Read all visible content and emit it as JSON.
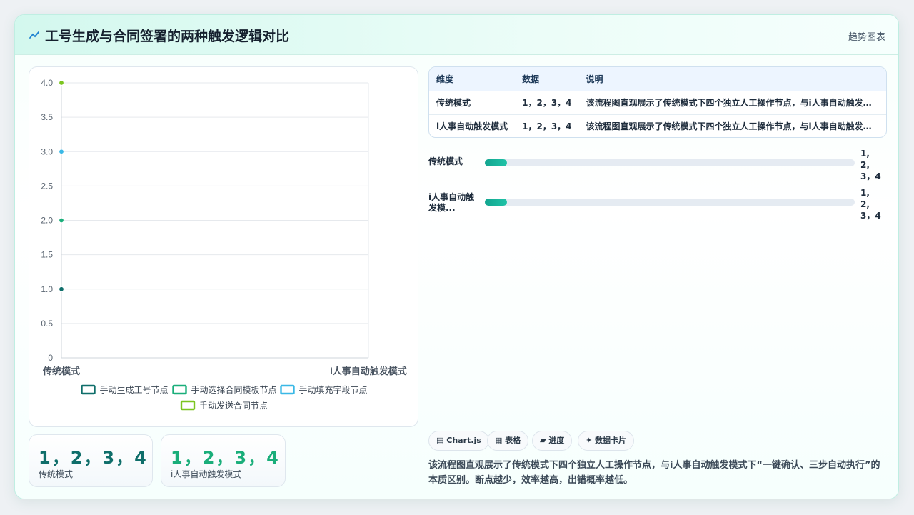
{
  "header": {
    "title": "工号生成与合同签署的两种触发逻辑对比",
    "tag": "趋势图表",
    "icon": "trend-line-icon"
  },
  "chart_data": {
    "type": "scatter",
    "categories": [
      "传统模式",
      "i人事自动触发模式"
    ],
    "ylim": [
      0,
      4
    ],
    "yticks": [
      "0",
      "0.5",
      "1.0",
      "1.5",
      "2.0",
      "2.5",
      "3.0",
      "3.5",
      "4.0"
    ],
    "series": [
      {
        "name": "手动生成工号节点",
        "values": [
          1,
          null
        ],
        "color": "#0f6e6a"
      },
      {
        "name": "手动选择合同模板节点",
        "values": [
          2,
          null
        ],
        "color": "#1aae7a"
      },
      {
        "name": "手动填充字段节点",
        "values": [
          3,
          null
        ],
        "color": "#3ab8e6"
      },
      {
        "name": "手动发送合同节点",
        "values": [
          4,
          null
        ],
        "color": "#7cc520"
      }
    ],
    "legend": "bottom",
    "grid": true
  },
  "stats": [
    {
      "value": "1，2，3，4",
      "label": "传统模式",
      "color": "#0f6e6a"
    },
    {
      "value": "1，2，3，4",
      "label": "i人事自动触发模式",
      "color": "#1aae7a"
    }
  ],
  "table": {
    "headers": [
      "维度",
      "数据",
      "说明"
    ],
    "rows": [
      [
        "传统模式",
        "1，2，3，4",
        "该流程图直观展示了传统模式下四个独立人工操作节点，与i人事自动触发模..."
      ],
      [
        "i人事自动触发模式",
        "1，2，3，4",
        "该流程图直观展示了传统模式下四个独立人工操作节点，与i人事自动触发模..."
      ]
    ]
  },
  "progress": [
    {
      "label": "传统模式",
      "value_lines": [
        "1,",
        "2,",
        "3，4"
      ],
      "fraction": 0.06
    },
    {
      "label": "i人事自动触发模...",
      "label_lines": [
        "i人事自动触",
        "发模..."
      ],
      "value_lines": [
        "1,",
        "2,",
        "3，4"
      ],
      "fraction": 0.06
    }
  ],
  "chips": [
    {
      "icon": "chart-icon",
      "label": "Chart.js",
      "glyph": "▤"
    },
    {
      "icon": "table-icon",
      "label": "表格",
      "glyph": "▦"
    },
    {
      "icon": "progress-icon",
      "label": "进度",
      "glyph": "▰"
    },
    {
      "icon": "sparkle-icon",
      "label": "数据卡片",
      "glyph": "✦"
    }
  ],
  "description": "该流程图直观展示了传统模式下四个独立人工操作节点，与i人事自动触发模式下“一键确认、三步自动执行”的本质区别。断点越少，效率越高，出错概率越低。"
}
